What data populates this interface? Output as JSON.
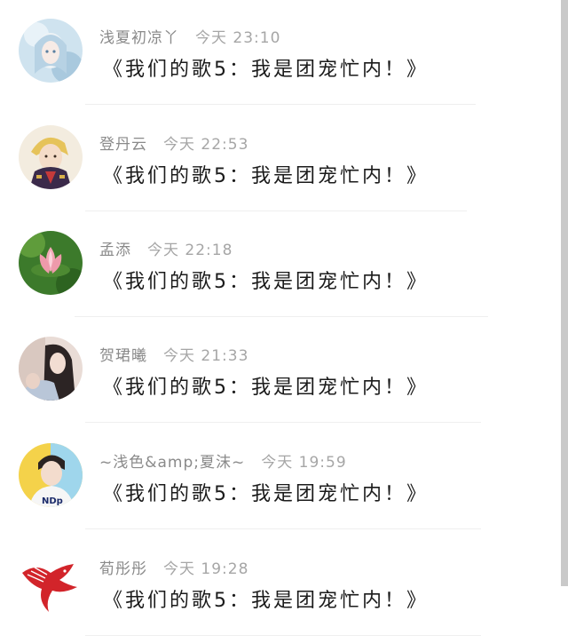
{
  "comments": [
    {
      "username": "浅夏初凉丫",
      "time": "今天 23:10",
      "message": "《我们的歌5：我是团宠忙内！》",
      "avatar": "anime-girl-avatar"
    },
    {
      "username": "登丹云",
      "time": "今天 22:53",
      "message": "《我们的歌5：我是团宠忙内！》",
      "avatar": "anime-prince-avatar"
    },
    {
      "username": "孟添",
      "time": "今天 22:18",
      "message": "《我们的歌5：我是团宠忙内！》",
      "avatar": "lotus-avatar"
    },
    {
      "username": "贺珺曦",
      "time": "今天 21:33",
      "message": "《我们的歌5：我是团宠忙内！》",
      "avatar": "girl-photo-avatar"
    },
    {
      "username": "~浅色&amp;夏沫~",
      "time": "今天 19:59",
      "message": "《我们的歌5：我是团宠忙内！》",
      "avatar": "boy-photo-avatar"
    },
    {
      "username": "荀彤彤",
      "time": "今天 19:28",
      "message": "《我们的歌5：我是团宠忙内！》",
      "avatar": "red-bird-avatar"
    }
  ]
}
